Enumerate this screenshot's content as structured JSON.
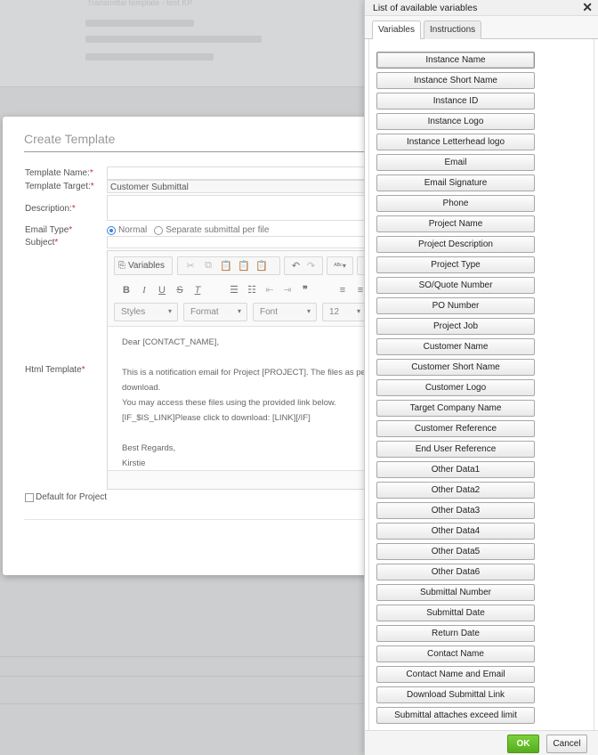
{
  "background": {
    "lines": [
      "Transmittal template - test KP",
      "",
      "",
      ""
    ]
  },
  "modal": {
    "title": "Create Template",
    "labels": {
      "template_name": "Template Name:",
      "template_target": "Template Target:",
      "description": "Description:",
      "email_type": "Email Type",
      "subject": "Subject",
      "html_template": "Html Template",
      "required_mark": "*"
    },
    "fields": {
      "template_name_value": "",
      "template_target_value": "Customer Submittal",
      "description_value": "",
      "subject_value": ""
    },
    "email_type_options": {
      "normal": "Normal",
      "separate": "Separate submittal per file",
      "selected": "Normal"
    },
    "default_for_project": "Default for Project",
    "editor": {
      "variables_button": "Variables",
      "styles_combo": "Styles",
      "format_combo": "Format",
      "font_combo": "Font",
      "size_combo": "12",
      "content_lines": [
        "Dear [CONTACT_NAME],",
        "",
        "This is a notification email for Project [PROJECT]. The files as per the",
        "download.",
        "You may access these files using the provided link below.",
        "[IF_$IS_LINK]Please click to download: [LINK][/IF]",
        "",
        "Best Regards,",
        "Kirstie"
      ]
    }
  },
  "panel": {
    "title": "List of available variables",
    "tabs": [
      {
        "label": "Variables",
        "active": true
      },
      {
        "label": "Instructions",
        "active": false
      }
    ],
    "variables": [
      "Instance Name",
      "Instance Short Name",
      "Instance ID",
      "Instance Logo",
      "Instance Letterhead logo",
      "Email",
      "Email Signature",
      "Phone",
      "Project Name",
      "Project Description",
      "Project Type",
      "SO/Quote Number",
      "PO Number",
      "Project Job",
      "Customer Name",
      "Customer Short Name",
      "Customer Logo",
      "Target Company Name",
      "Customer Reference",
      "End User Reference",
      "Other Data1",
      "Other Data2",
      "Other Data3",
      "Other Data4",
      "Other Data5",
      "Other Data6",
      "Submittal Number",
      "Submittal Date",
      "Return Date",
      "Contact Name",
      "Contact Name and Email",
      "Download Submittal Link",
      "Submittal attaches exceed limit"
    ],
    "ok_label": "OK",
    "cancel_label": "Cancel",
    "colors": {
      "ok": "#5fb829"
    }
  }
}
